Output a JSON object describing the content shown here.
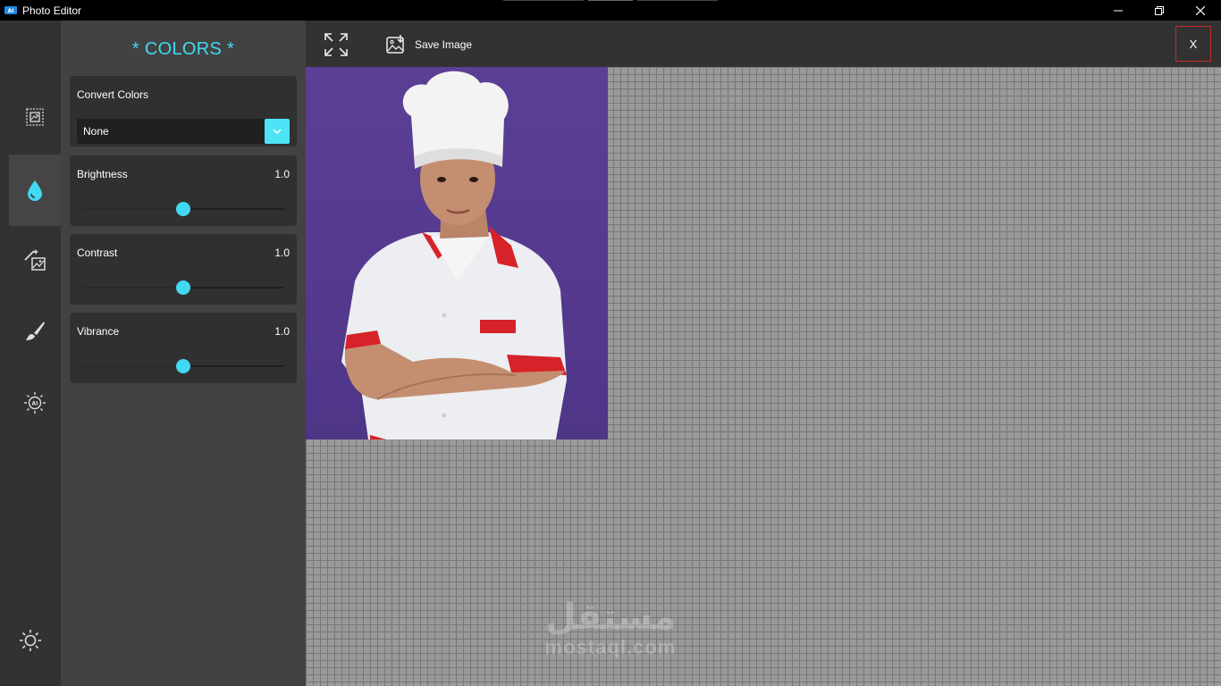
{
  "window": {
    "title": "Photo Editor",
    "controls": {
      "minimize": "minimize-icon",
      "restore": "restore-icon",
      "close": "close-icon"
    }
  },
  "iconbar": {
    "items": [
      {
        "name": "crop",
        "icon": "crop-frame-icon",
        "active": false
      },
      {
        "name": "colors",
        "icon": "water-drop-icon",
        "active": true
      },
      {
        "name": "effects",
        "icon": "magic-wand-image-icon",
        "active": false
      },
      {
        "name": "draw",
        "icon": "brush-icon",
        "active": false
      },
      {
        "name": "ai-enhance",
        "icon": "ai-bulb-icon",
        "active": false
      }
    ],
    "theme_toggle": "sun-icon"
  },
  "panel": {
    "title": "* COLORS *",
    "convert_colors": {
      "label": "Convert Colors",
      "selected": "None"
    },
    "brightness": {
      "label": "Brightness",
      "value": "1.0",
      "fraction": 0.5
    },
    "contrast": {
      "label": "Contrast",
      "value": "1.0",
      "fraction": 0.5
    },
    "vibrance": {
      "label": "Vibrance",
      "value": "1.0",
      "fraction": 0.5
    }
  },
  "toolbar": {
    "fullscreen_icon": "expand-icon",
    "save_label": "Save Image",
    "close_label": "X"
  },
  "watermark": {
    "arabic": "مستقل",
    "latin": "mostaql.com"
  },
  "colors": {
    "accent": "#41d9f2",
    "panel_bg": "#424242",
    "iconbar_bg": "#323232",
    "card_bg": "#303030",
    "close_border": "#c62828",
    "photo_bg": "#55398e"
  }
}
